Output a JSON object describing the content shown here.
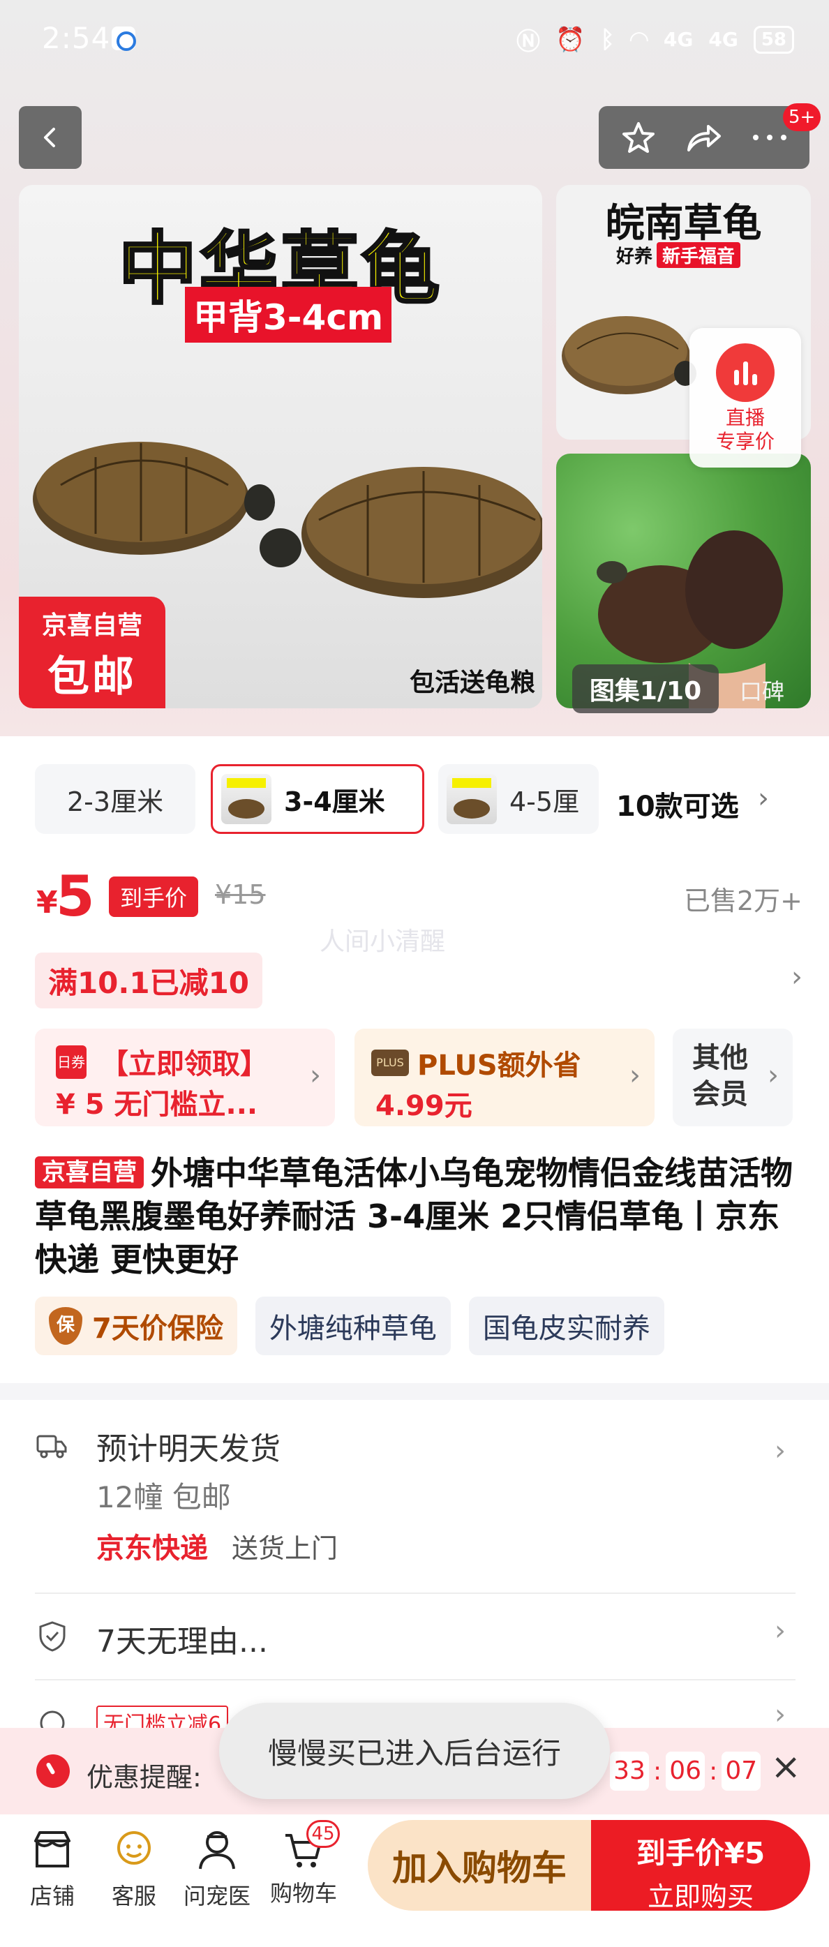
{
  "status_bar": {
    "time": "2:54",
    "net1": "4G",
    "net2": "4G",
    "battery": "58"
  },
  "header": {
    "more_badge": "5+"
  },
  "gallery": {
    "main_title": "中华草龟",
    "main_subtitle": "甲背3-4cm",
    "main_badge_top": "京喜自营",
    "main_badge_bottom": "包邮",
    "main_caption": "包活送龟粮",
    "side_title": "皖南草龟",
    "side_tag1": "好养",
    "side_tag2": "新手福音",
    "counter": "图集1/10",
    "review_link": "口碑"
  },
  "live": {
    "line1": "直播",
    "line2": "专享价"
  },
  "variants": {
    "items": [
      {
        "label": "2-3厘米"
      },
      {
        "label": "3-4厘米"
      },
      {
        "label": "4-5厘"
      }
    ],
    "count_label": "10款可选"
  },
  "price": {
    "symbol": "¥",
    "value": "5",
    "tag": "到手价",
    "original": "¥15",
    "sold": "已售2万+",
    "watermark": "人间小清醒"
  },
  "coupon": {
    "label": "满10.1已减10"
  },
  "promos": {
    "a_icon": "日券",
    "a_line1": "【立即领取】",
    "a_line2": "¥ 5 无门槛立...",
    "b_tag": "PLUS",
    "b_line1": "PLUS额外省",
    "b_line2": "4.99元",
    "c_line1": "其他会员"
  },
  "product": {
    "self_tag": "京喜自营",
    "title": "外塘中华草龟活体小乌龟宠物情侣金线苗活物草龟黑腹墨龟好养耐活 3-4厘米 2只情侣草龟丨京东快递 更快更好"
  },
  "features": {
    "warranty_icon": "保",
    "warranty": "7天价保险",
    "f2": "外塘纯种草龟",
    "f3": "国龟皮实耐养"
  },
  "shipping": {
    "line1": "预计明天发货",
    "line2": "12幢   包邮",
    "carrier": "京东快递",
    "service": "送货上门",
    "returns": "7天无理由...",
    "partial_tag": "无门槛立减6"
  },
  "reminder": {
    "label": "优惠提醒:",
    "timer": [
      "33",
      "06",
      "07"
    ],
    "toast": "慢慢买已进入后台运行"
  },
  "bottom_nav": {
    "store": "店铺",
    "service": "客服",
    "vet": "问宠医",
    "cart": "购物车",
    "cart_count": "45",
    "add_to_cart": "加入购物车",
    "buy_line1": "到手价¥5",
    "buy_line2": "立即购买"
  },
  "colors": {
    "accent": "#e8222e",
    "plus": "#b04a00"
  }
}
